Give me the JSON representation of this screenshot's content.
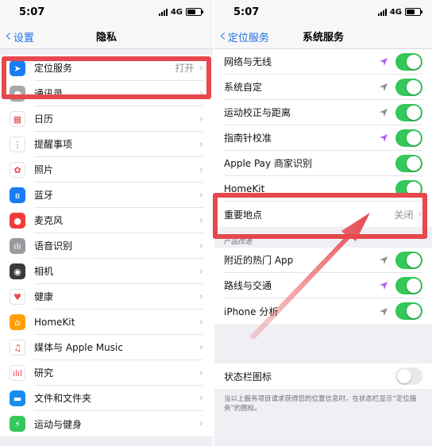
{
  "left": {
    "status": {
      "time": "5:07",
      "network": "4G"
    },
    "nav": {
      "back": "设置",
      "title": "隐私"
    },
    "items": [
      {
        "label": "定位服务",
        "value": "打开",
        "icon": "location-arrow-icon",
        "color": "#1a7cf5",
        "glyph": "➤"
      },
      {
        "label": "通讯录",
        "icon": "contacts-icon",
        "color": "#a7a7ab",
        "glyph": "●"
      },
      {
        "label": "日历",
        "icon": "calendar-icon",
        "color": "#ffffff",
        "glyph": "▦"
      },
      {
        "label": "提醒事项",
        "icon": "reminders-icon",
        "color": "#ffffff",
        "glyph": "⋮"
      },
      {
        "label": "照片",
        "icon": "photos-icon",
        "color": "#ffffff",
        "glyph": "✿"
      },
      {
        "label": "蓝牙",
        "icon": "bluetooth-icon",
        "color": "#1a7cf5",
        "glyph": "ʙ"
      },
      {
        "label": "麦克风",
        "icon": "microphone-icon",
        "color": "#f03c3c",
        "glyph": "●"
      },
      {
        "label": "语音识别",
        "icon": "speech-recognition-icon",
        "color": "#9a9aa0",
        "glyph": "ılı"
      },
      {
        "label": "相机",
        "icon": "camera-icon",
        "color": "#3a3a3c",
        "glyph": "◉"
      },
      {
        "label": "健康",
        "icon": "health-icon",
        "color": "#ffffff",
        "glyph": "♥"
      },
      {
        "label": "HomeKit",
        "icon": "homekit-icon",
        "color": "#ff9f0a",
        "glyph": "⌂"
      },
      {
        "label": "媒体与 Apple Music",
        "icon": "music-icon",
        "color": "#ffffff",
        "glyph": "♫"
      },
      {
        "label": "研究",
        "icon": "research-icon",
        "color": "#ffffff",
        "glyph": "ılıl"
      },
      {
        "label": "文件和文件夹",
        "icon": "folder-icon",
        "color": "#1a8cf0",
        "glyph": "▬"
      },
      {
        "label": "运动与健身",
        "icon": "fitness-icon",
        "color": "#34c759",
        "glyph": "⚡"
      }
    ]
  },
  "right": {
    "status": {
      "time": "5:07",
      "network": "4G"
    },
    "nav": {
      "back": "定位服务",
      "title": "系统服务"
    },
    "items": [
      {
        "label": "网络与无线",
        "toggle": true,
        "arrow": "#b15dff"
      },
      {
        "label": "系统自定",
        "toggle": true,
        "arrow": "#8e8e93"
      },
      {
        "label": "运动校正与距离",
        "toggle": true,
        "arrow": "#8e8e93"
      },
      {
        "label": "指南针校准",
        "toggle": true,
        "arrow": "#b15dff"
      },
      {
        "label": "Apple Pay 商家识别",
        "toggle": true
      },
      {
        "label": "HomeKit",
        "toggle": true
      },
      {
        "label": "重要地点",
        "value": "关闭"
      }
    ],
    "section_header": "产品改进",
    "improve_items": [
      {
        "label": "附近的热门 App",
        "toggle": true,
        "arrow": "#8e8e93"
      },
      {
        "label": "路线与交通",
        "toggle": true,
        "arrow": "#b15dff"
      },
      {
        "label": "iPhone 分析",
        "toggle": true,
        "arrow": "#8e8e93"
      }
    ],
    "status_bar_icon": {
      "label": "状态栏图标",
      "toggle": false
    },
    "footer": "当以上服务项目请求获得您的位置信息时，在状态栏显示“定位服务”的图标。"
  },
  "annotation_color": "#e5484d"
}
